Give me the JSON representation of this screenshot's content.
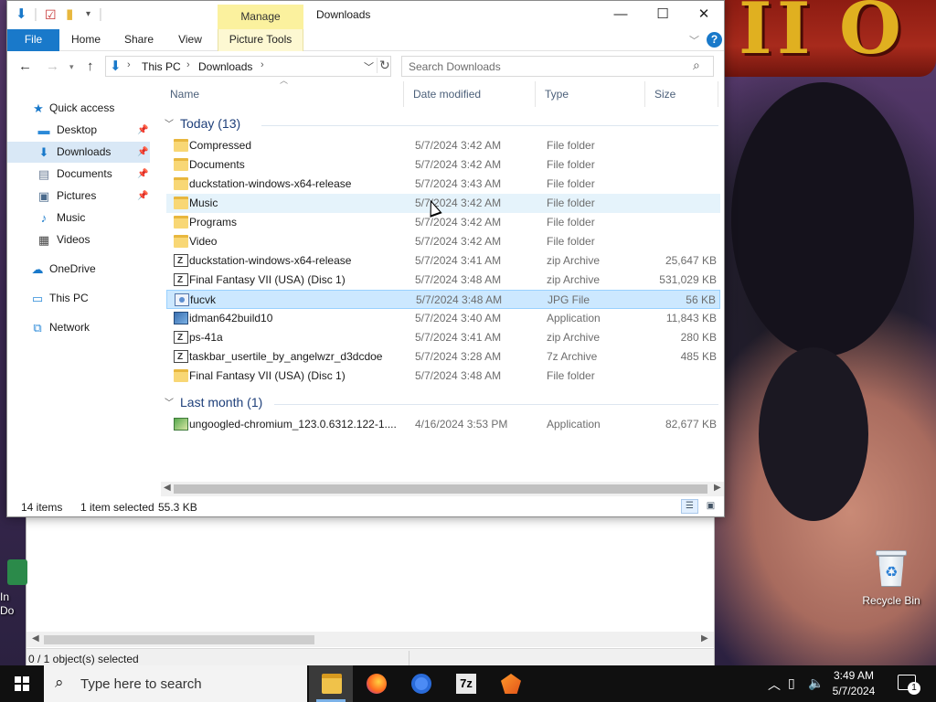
{
  "window": {
    "title": "Downloads",
    "context_tab": "Manage",
    "controls": {
      "minimize": "—",
      "maximize": "☐",
      "close": "✕"
    }
  },
  "ribbon": {
    "tabs": [
      "File",
      "Home",
      "Share",
      "View",
      "Picture Tools"
    ],
    "help": "?"
  },
  "address": {
    "segments": [
      "This PC",
      "Downloads"
    ]
  },
  "search": {
    "placeholder": "Search Downloads"
  },
  "nav_pane": {
    "items": [
      {
        "label": "Quick access",
        "icon": "star-icon"
      },
      {
        "label": "Desktop",
        "icon": "desktop-icon",
        "pinned": true
      },
      {
        "label": "Downloads",
        "icon": "download-icon",
        "pinned": true,
        "selected": true
      },
      {
        "label": "Documents",
        "icon": "documents-icon",
        "pinned": true
      },
      {
        "label": "Pictures",
        "icon": "pictures-icon",
        "pinned": true
      },
      {
        "label": "Music",
        "icon": "music-icon"
      },
      {
        "label": "Videos",
        "icon": "videos-icon"
      },
      {
        "label": "OneDrive",
        "icon": "cloud-icon"
      },
      {
        "label": "This PC",
        "icon": "computer-icon"
      },
      {
        "label": "Network",
        "icon": "network-icon"
      }
    ]
  },
  "columns": [
    "Name",
    "Date modified",
    "Type",
    "Size"
  ],
  "groups": [
    {
      "label": "Today (13)",
      "files": [
        {
          "name": "Compressed",
          "date": "5/7/2024 3:42 AM",
          "type": "File folder",
          "size": "",
          "icon": "folder-icon"
        },
        {
          "name": "Documents",
          "date": "5/7/2024 3:42 AM",
          "type": "File folder",
          "size": "",
          "icon": "folder-icon"
        },
        {
          "name": "duckstation-windows-x64-release",
          "date": "5/7/2024 3:43 AM",
          "type": "File folder",
          "size": "",
          "icon": "folder-icon"
        },
        {
          "name": "Music",
          "date": "5/7/2024 3:42 AM",
          "type": "File folder",
          "size": "",
          "icon": "folder-icon",
          "hover": true
        },
        {
          "name": "Programs",
          "date": "5/7/2024 3:42 AM",
          "type": "File folder",
          "size": "",
          "icon": "folder-icon"
        },
        {
          "name": "Video",
          "date": "5/7/2024 3:42 AM",
          "type": "File folder",
          "size": "",
          "icon": "folder-icon"
        },
        {
          "name": "duckstation-windows-x64-release",
          "date": "5/7/2024 3:41 AM",
          "type": "zip Archive",
          "size": "25,647 KB",
          "icon": "zip-icon"
        },
        {
          "name": "Final Fantasy VII (USA) (Disc 1)",
          "date": "5/7/2024 3:48 AM",
          "type": "zip Archive",
          "size": "531,029 KB",
          "icon": "zip-icon"
        },
        {
          "name": "fucvk",
          "date": "5/7/2024 3:48 AM",
          "type": "JPG File",
          "size": "56 KB",
          "icon": "image-file-icon",
          "selected": true
        },
        {
          "name": "idman642build10",
          "date": "5/7/2024 3:40 AM",
          "type": "Application",
          "size": "11,843 KB",
          "icon": "app-icon"
        },
        {
          "name": "ps-41a",
          "date": "5/7/2024 3:41 AM",
          "type": "zip Archive",
          "size": "280 KB",
          "icon": "zip-icon"
        },
        {
          "name": "taskbar_usertile_by_angelwzr_d3dcdoe",
          "date": "5/7/2024 3:28 AM",
          "type": "7z Archive",
          "size": "485 KB",
          "icon": "zip-icon"
        },
        {
          "name": "Final Fantasy VII (USA) (Disc 1)",
          "date": "5/7/2024 3:48 AM",
          "type": "File folder",
          "size": "",
          "icon": "folder-icon"
        }
      ]
    },
    {
      "label": "Last month (1)",
      "files": [
        {
          "name": "ungoogled-chromium_123.0.6312.122-1....",
          "date": "4/16/2024 3:53 PM",
          "type": "Application",
          "size": "82,677 KB",
          "icon": "installer-icon"
        }
      ]
    }
  ],
  "status": {
    "items": "14 items",
    "selected": "1 item selected",
    "size": "55.3 KB"
  },
  "bg_window": {
    "status": "0 / 1 object(s) selected"
  },
  "desktop": {
    "recycle_bin": "Recycle Bin",
    "partial_icon": "In\nDo"
  },
  "taskbar": {
    "search_placeholder": "Type here to search",
    "apps": [
      {
        "name": "file-explorer",
        "active": true
      },
      {
        "name": "firefox"
      },
      {
        "name": "chrome"
      },
      {
        "name": "7zip",
        "label": "7z"
      },
      {
        "name": "app-fox"
      }
    ],
    "clock": {
      "time": "3:49 AM",
      "date": "5/7/2024"
    },
    "notifications": "1"
  },
  "colors": {
    "accent": "#1979ca",
    "selection": "#cce8ff",
    "manage_tab": "#fbf19e"
  }
}
